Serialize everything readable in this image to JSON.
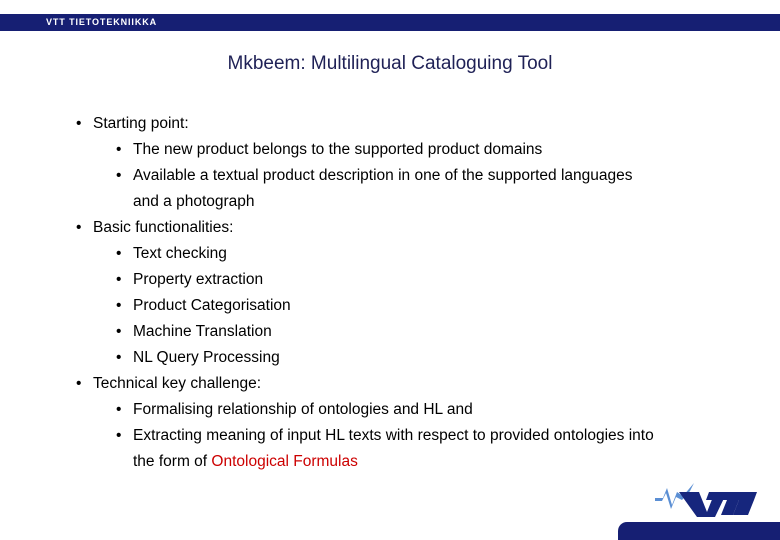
{
  "header": {
    "org_label": "VTT TIETOTEKNIIKKA",
    "bar_color": "#161F73"
  },
  "title": {
    "text": "Mkbeem: Multilingual Cataloguing Tool",
    "color": "#1F2156"
  },
  "content": {
    "bullet_glyph": "•",
    "items": [
      {
        "level": 1,
        "text": "Starting point:"
      },
      {
        "level": 2,
        "text": "The new product belongs to the supported product domains"
      },
      {
        "level": 2,
        "text": "Available a textual product description in one of the supported languages and a photograph"
      },
      {
        "level": 1,
        "text": "Basic functionalities:"
      },
      {
        "level": 2,
        "text": "Text checking"
      },
      {
        "level": 2,
        "text": "Property extraction"
      },
      {
        "level": 2,
        "text": "Product Categorisation"
      },
      {
        "level": 2,
        "text": "Machine Translation"
      },
      {
        "level": 2,
        "text": "NL Query Processing"
      },
      {
        "level": 1,
        "text": "Technical key challenge:"
      },
      {
        "level": 2,
        "text": "Formalising  relationship of ontologies and HL and"
      },
      {
        "level": 2,
        "text": "Extracting meaning of input HL texts with respect to provided ontologies into the form of ",
        "highlight": "Ontological Formulas",
        "highlight_color": "#CC0000"
      }
    ]
  },
  "footer": {
    "logo_name": "vtt-logo",
    "logo_wordmark": "VTT",
    "logo_dark": "#16267D",
    "logo_light": "#5B8FD4",
    "bar_color": "#161F73"
  }
}
